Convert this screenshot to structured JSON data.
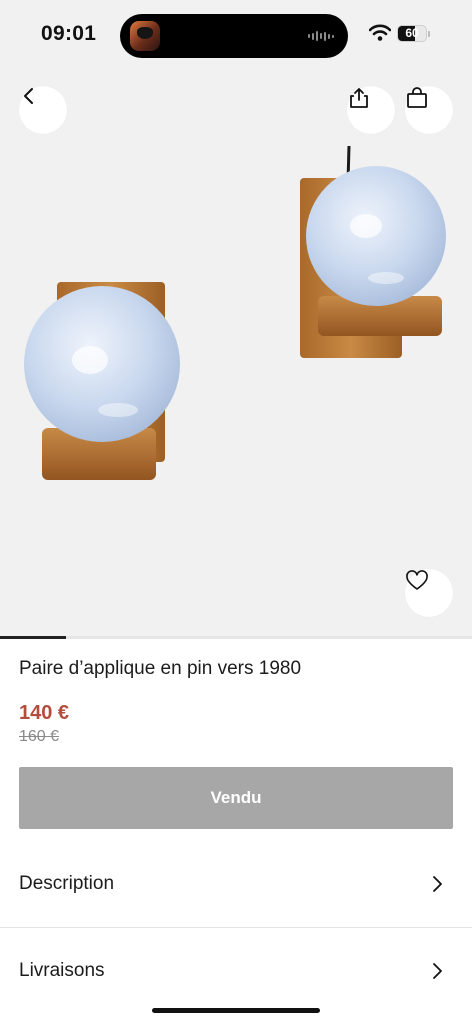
{
  "status_bar": {
    "time": "09:01",
    "battery": "60",
    "battery_level": 0.6,
    "icons": [
      "wifi-icon",
      "battery-icon",
      "audio-wave-icon"
    ]
  },
  "nav": {
    "icons": {
      "back": "chevron-left-icon",
      "share": "share-icon",
      "cart": "shopping-bag-icon",
      "favorite": "heart-icon"
    }
  },
  "carousel": {
    "progress": 0.14
  },
  "product": {
    "title": "Paire d’applique en pin vers 1980",
    "price": "140 €",
    "old_price": "160 €",
    "button_label": "Vendu"
  },
  "sections": [
    {
      "label": "Description",
      "icon": "chevron-right-icon"
    },
    {
      "label": "Livraisons",
      "icon": "chevron-right-icon"
    }
  ],
  "colors": {
    "price": "#b34d3c",
    "button": "#a7a7a7",
    "background": "#f1f1f1"
  }
}
